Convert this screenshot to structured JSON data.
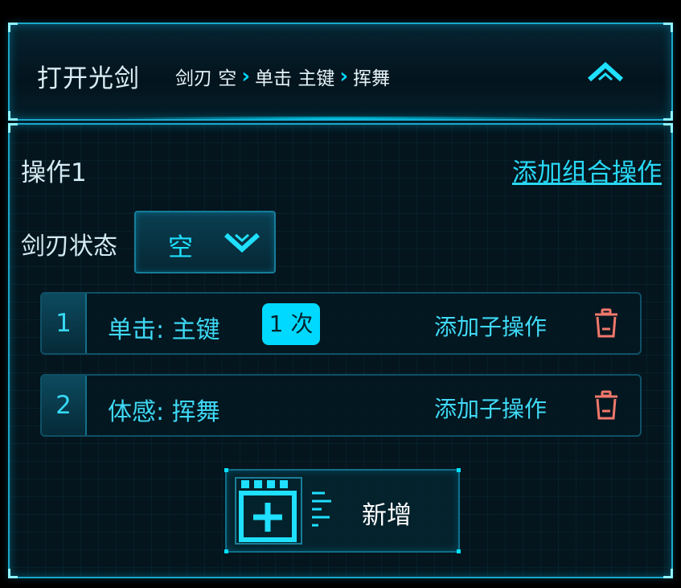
{
  "header": {
    "title": "打开光剑",
    "breadcrumb": [
      "剑刃 空",
      "单击 主键",
      "挥舞"
    ],
    "collapse_icon": "chevron-up-icon"
  },
  "operation": {
    "title": "操作1",
    "add_combo_label": "添加组合操作",
    "blade_state_label": "剑刃状态",
    "blade_state_value": "空"
  },
  "steps": [
    {
      "index": "1",
      "text": "单击: 主键",
      "count": "1 次",
      "add_sub_label": "添加子操作"
    },
    {
      "index": "2",
      "text": "体感: 挥舞",
      "add_sub_label": "添加子操作"
    }
  ],
  "add_button": {
    "label": "新增"
  },
  "colors": {
    "accent": "#00d9ff",
    "text": "#d4ebf3",
    "delete": "#f0776b",
    "border": "#1aa7c9",
    "background": "#04151d"
  }
}
